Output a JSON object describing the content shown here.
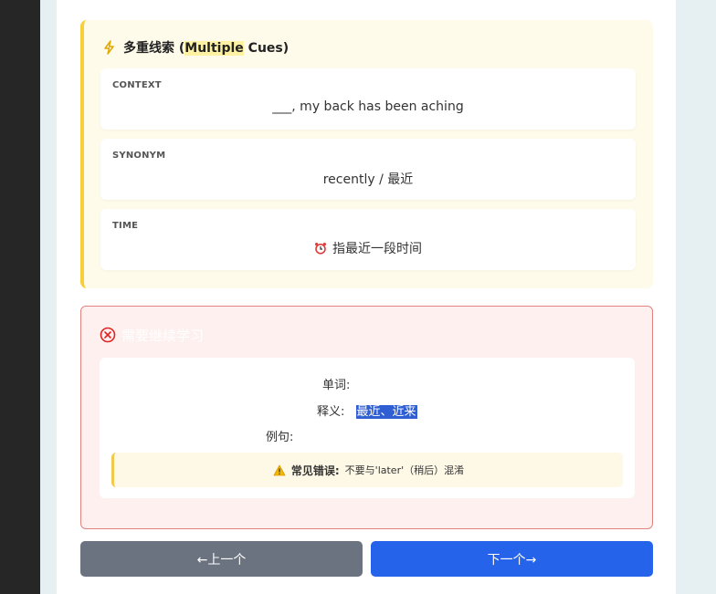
{
  "cues": {
    "title_prefix": "多重线索 (",
    "title_highlight": "Multiple",
    "title_suffix": " Cues)",
    "items": [
      {
        "label": "CONTEXT",
        "value": "___, my back has been aching"
      },
      {
        "label": "SYNONYM",
        "value": "recently / 最近"
      },
      {
        "label": "TIME",
        "value": "指最近一段时间",
        "icon": "alarm-clock-icon"
      }
    ]
  },
  "wrong": {
    "title": "需要继续学习",
    "word_label": "单词:",
    "word_value": "",
    "meaning_label": "释义:",
    "meaning_value": "最近、近来",
    "example_label": "例句:",
    "example_value": "",
    "tip_label": "常见错误:",
    "tip_text": "不要与'later'（稍后）混淆"
  },
  "nav": {
    "prev_label": "←上一个",
    "next_label": "下一个→"
  },
  "colors": {
    "cue_accent": "#f6cf3b",
    "error_border": "#e38381",
    "error_icon": "#e02424",
    "prev_button": "#6b7280",
    "next_button": "#2563eb",
    "selection": "#2f5fd2"
  }
}
